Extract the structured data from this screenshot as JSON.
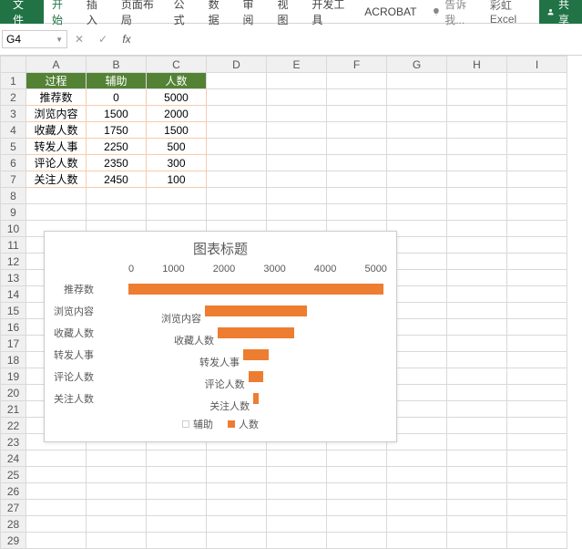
{
  "ribbon": {
    "file": "文件",
    "tabs": [
      "开始",
      "插入",
      "页面布局",
      "公式",
      "数据",
      "审阅",
      "视图",
      "开发工具",
      "ACROBAT"
    ],
    "active_tab_index": 0,
    "tell_me": "告诉我...",
    "user": "彩虹 Excel",
    "share": "共享"
  },
  "formula_bar": {
    "namebox": "G4",
    "formula": ""
  },
  "columns": [
    "A",
    "B",
    "C",
    "D",
    "E",
    "F",
    "G",
    "H",
    "I"
  ],
  "rows": 29,
  "table": {
    "headers": [
      "过程",
      "辅助",
      "人数"
    ],
    "data": [
      [
        "推荐数",
        "0",
        "5000"
      ],
      [
        "浏览内容",
        "1500",
        "2000"
      ],
      [
        "收藏人数",
        "1750",
        "1500"
      ],
      [
        "转发人事",
        "2250",
        "500"
      ],
      [
        "评论人数",
        "2350",
        "300"
      ],
      [
        "关注人数",
        "2450",
        "100"
      ]
    ]
  },
  "chart_data": {
    "type": "bar",
    "title": "图表标题",
    "orientation": "horizontal",
    "x_ticks": [
      0,
      1000,
      2000,
      3000,
      4000,
      5000
    ],
    "xlim": [
      0,
      5000
    ],
    "categories": [
      "推荐数",
      "浏览内容",
      "收藏人数",
      "转发人事",
      "评论人数",
      "关注人数"
    ],
    "series": [
      {
        "name": "辅助",
        "values": [
          0,
          1500,
          1750,
          2250,
          2350,
          2450
        ],
        "color": "transparent"
      },
      {
        "name": "人数",
        "values": [
          5000,
          2000,
          1500,
          500,
          300,
          100
        ],
        "color": "#ed7d31"
      }
    ],
    "legend": [
      "辅助",
      "人数"
    ],
    "bar_data_labels": [
      "",
      "浏览内容",
      "收藏人数",
      "转发人事",
      "评论人数",
      "关注人数"
    ]
  }
}
